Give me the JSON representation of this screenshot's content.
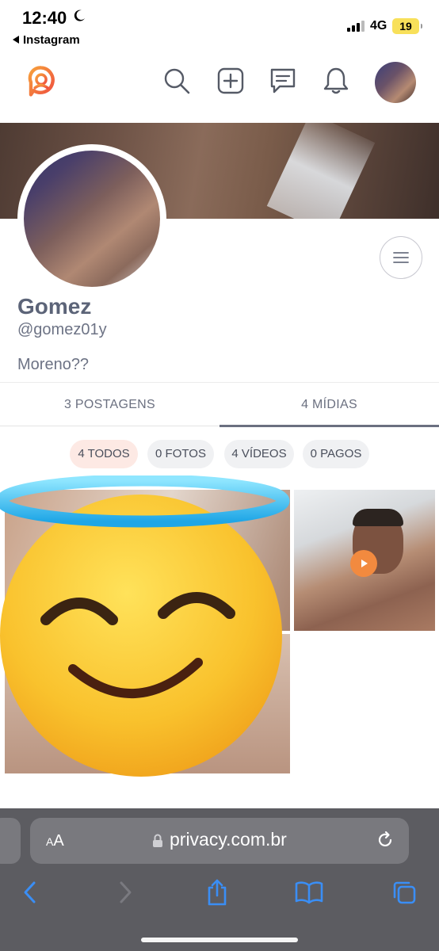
{
  "status_bar": {
    "time": "12:40",
    "back_app": "Instagram",
    "network": "4G",
    "battery": "19"
  },
  "header": {
    "logo_icon": "privacy-logo-icon",
    "icons": [
      "search-icon",
      "add-post-icon",
      "messages-icon",
      "notifications-icon"
    ],
    "accent_color": "#f2663f"
  },
  "profile": {
    "name": "Gomez",
    "handle": "@gomez01y",
    "bio": "Moreno??"
  },
  "tabs": [
    {
      "label": "3 POSTAGENS",
      "active": false
    },
    {
      "label": "4 MÍDIAS",
      "active": true
    }
  ],
  "filters": [
    {
      "label": "4 TODOS",
      "active": true
    },
    {
      "label": "0 FOTOS",
      "active": false
    },
    {
      "label": "4 VÍDEOS",
      "active": false
    },
    {
      "label": "0 PAGOS",
      "active": false
    }
  ],
  "browser": {
    "text_size_label": "AA",
    "url": "privacy.com.br"
  }
}
